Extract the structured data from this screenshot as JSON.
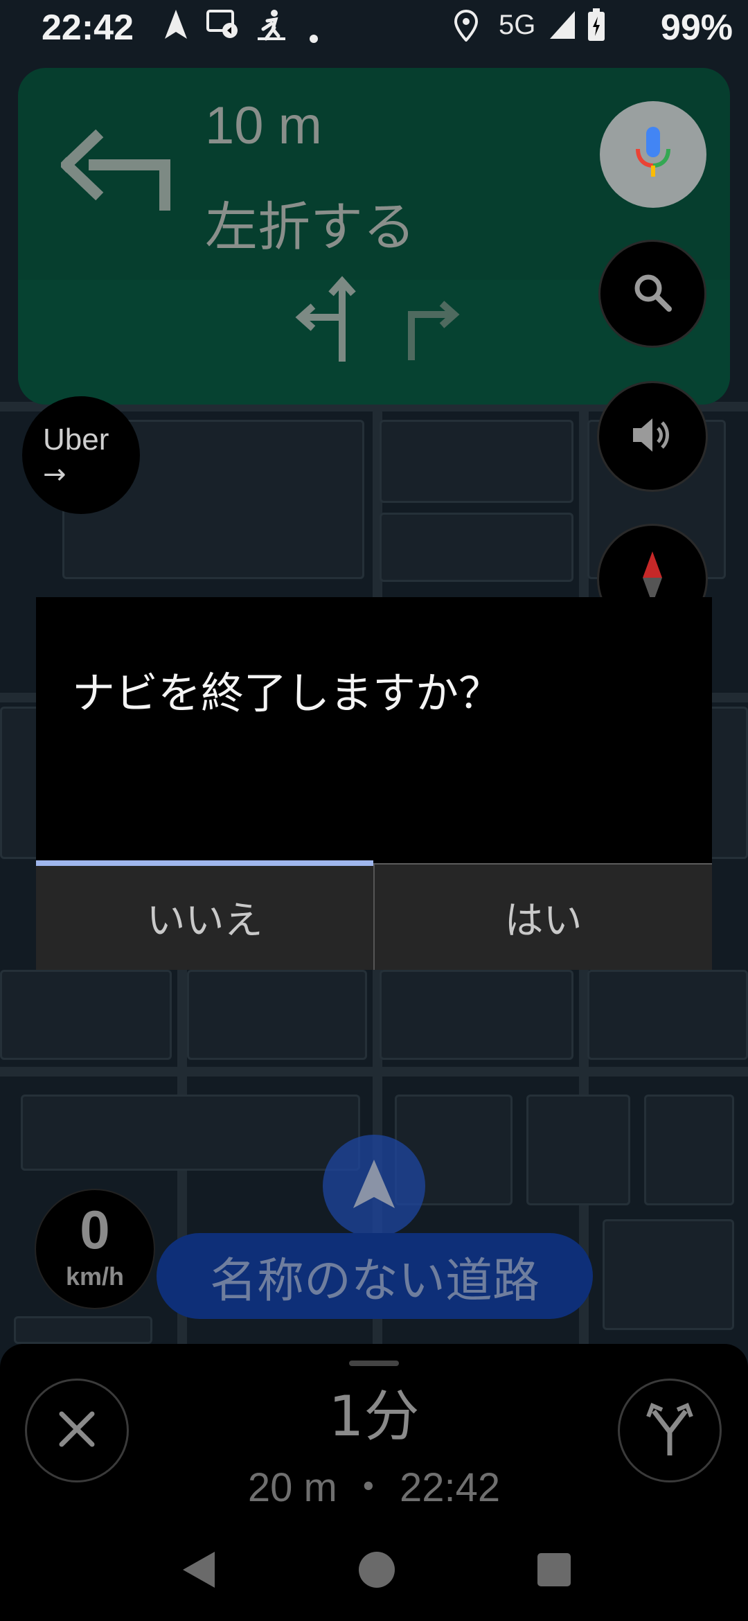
{
  "status_bar": {
    "time": "22:42",
    "network": "5G",
    "battery": "99%",
    "icons": [
      "navigation-icon",
      "screen-cast-icon",
      "running-icon",
      "dot-icon",
      "location-icon",
      "signal-icon",
      "battery-icon"
    ]
  },
  "nav_card": {
    "distance": "10 m",
    "instruction": "左折する",
    "maneuver_icon": "turn-left-icon",
    "lane_icons": [
      "lane-straight-left-icon",
      "lane-right-icon"
    ],
    "colors": {
      "card": "#063e2e"
    }
  },
  "fabs": [
    "mic-icon",
    "search-icon",
    "volume-icon",
    "compass-icon"
  ],
  "uber": {
    "label": "Uber",
    "arrow": "→"
  },
  "dialog": {
    "title": "ナビを終了しますか？",
    "no_label": "いいえ",
    "yes_label": "はい"
  },
  "speed": {
    "value": "0",
    "unit": "km/h"
  },
  "road_name": "名称のない道路",
  "bottom_panel": {
    "eta_duration": "1分",
    "trip_details": "20 m ・ 22:42"
  },
  "system_nav": [
    "back-icon",
    "home-icon",
    "recents-icon"
  ]
}
